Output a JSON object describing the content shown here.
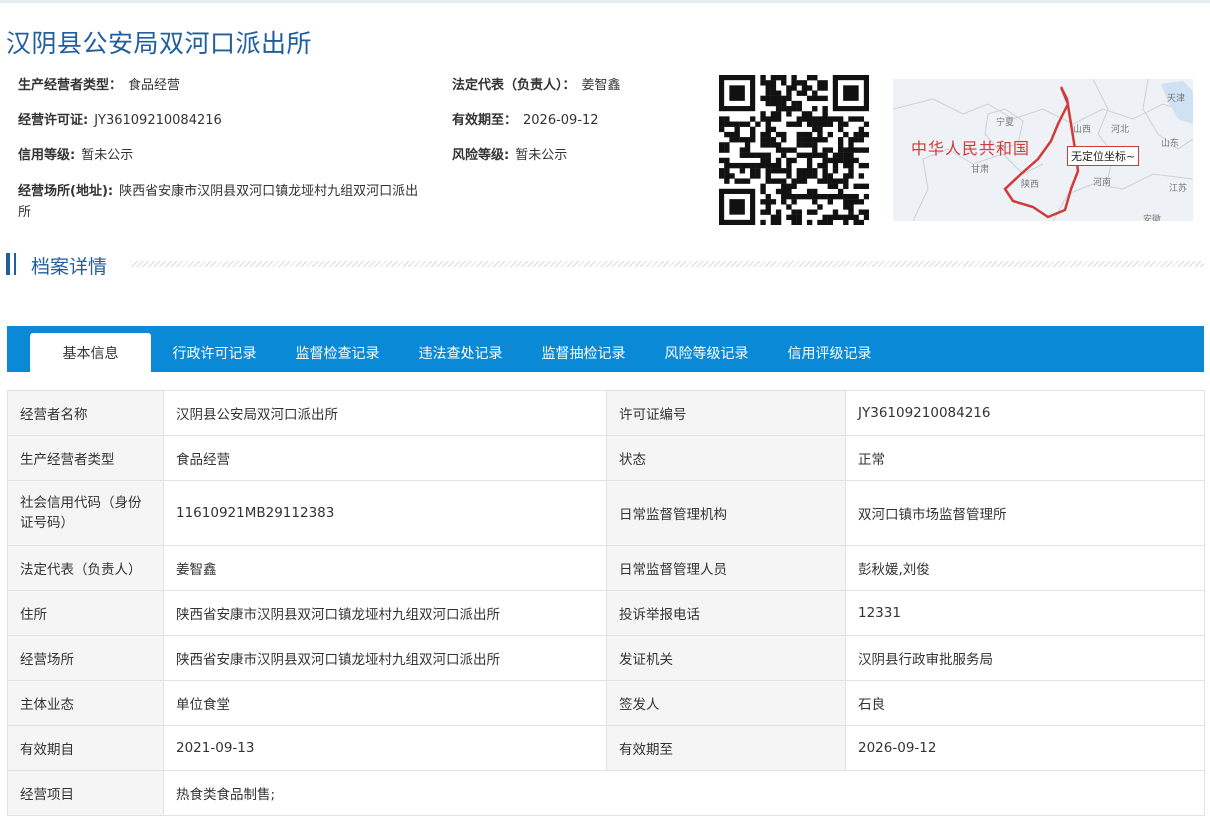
{
  "page": {
    "title": "汉阴县公安局双河口派出所"
  },
  "summary": {
    "producer_type_label": "生产经营者类型：",
    "producer_type_value": "食品经营",
    "license_no_label": "经营许可证:",
    "license_no_value": "JY36109210084216",
    "credit_level_label": "信用等级:",
    "credit_level_value": "暂未公示",
    "address_label": "经营场所(地址):",
    "address_value": "陕西省安康市汉阴县双河口镇龙垭村九组双河口派出所",
    "legal_rep_label": "法定代表（负责人）：",
    "legal_rep_value": "姜智鑫",
    "valid_until_label": "有效期至：",
    "valid_until_value": "2026-09-12",
    "risk_level_label": "风险等级:",
    "risk_level_value": "暂未公示"
  },
  "map": {
    "country_label": "中华人民共和国",
    "badge": "无定位坐标~",
    "provinces": [
      "宁夏",
      "甘肃",
      "陕西",
      "河南",
      "山西",
      "河北",
      "天津",
      "山东",
      "江苏",
      "安徽"
    ]
  },
  "section": {
    "title": "档案详情"
  },
  "tabs": [
    {
      "label": "基本信息",
      "active": true
    },
    {
      "label": "行政许可记录",
      "active": false
    },
    {
      "label": "监督检查记录",
      "active": false
    },
    {
      "label": "违法查处记录",
      "active": false
    },
    {
      "label": "监督抽检记录",
      "active": false
    },
    {
      "label": "风险等级记录",
      "active": false
    },
    {
      "label": "信用评级记录",
      "active": false
    }
  ],
  "details": {
    "r1": {
      "k1": "经营者名称",
      "v1": "汉阴县公安局双河口派出所",
      "k2": "许可证编号",
      "v2": "JY36109210084216"
    },
    "r2": {
      "k1": "生产经营者类型",
      "v1": "食品经营",
      "k2": "状态",
      "v2": "正常"
    },
    "r3": {
      "k1": "社会信用代码（身份证号码）",
      "v1": "11610921MB29112383",
      "k2": "日常监督管理机构",
      "v2": "双河口镇市场监督管理所"
    },
    "r4": {
      "k1": "法定代表（负责人）",
      "v1": "姜智鑫",
      "k2": "日常监督管理人员",
      "v2": "彭秋媛,刘俊"
    },
    "r5": {
      "k1": "住所",
      "v1": "陕西省安康市汉阴县双河口镇龙垭村九组双河口派出所",
      "k2": "投诉举报电话",
      "v2": "12331"
    },
    "r6": {
      "k1": "经营场所",
      "v1": "陕西省安康市汉阴县双河口镇龙垭村九组双河口派出所",
      "k2": "发证机关",
      "v2": "汉阴县行政审批服务局"
    },
    "r7": {
      "k1": "主体业态",
      "v1": "单位食堂",
      "k2": "签发人",
      "v2": "石良"
    },
    "r8": {
      "k1": "有效期自",
      "v1": "2021-09-13",
      "k2": "有效期至",
      "v2": "2026-09-12"
    },
    "r9": {
      "k1": "经营项目",
      "v1": "热食类食品制售;"
    }
  },
  "colors": {
    "title_blue": "#1f5fa0",
    "tab_bar_blue": "#0a8ad6",
    "key_cell_bg": "#f5f5f5",
    "map_boundary_red": "#d23a3a"
  }
}
